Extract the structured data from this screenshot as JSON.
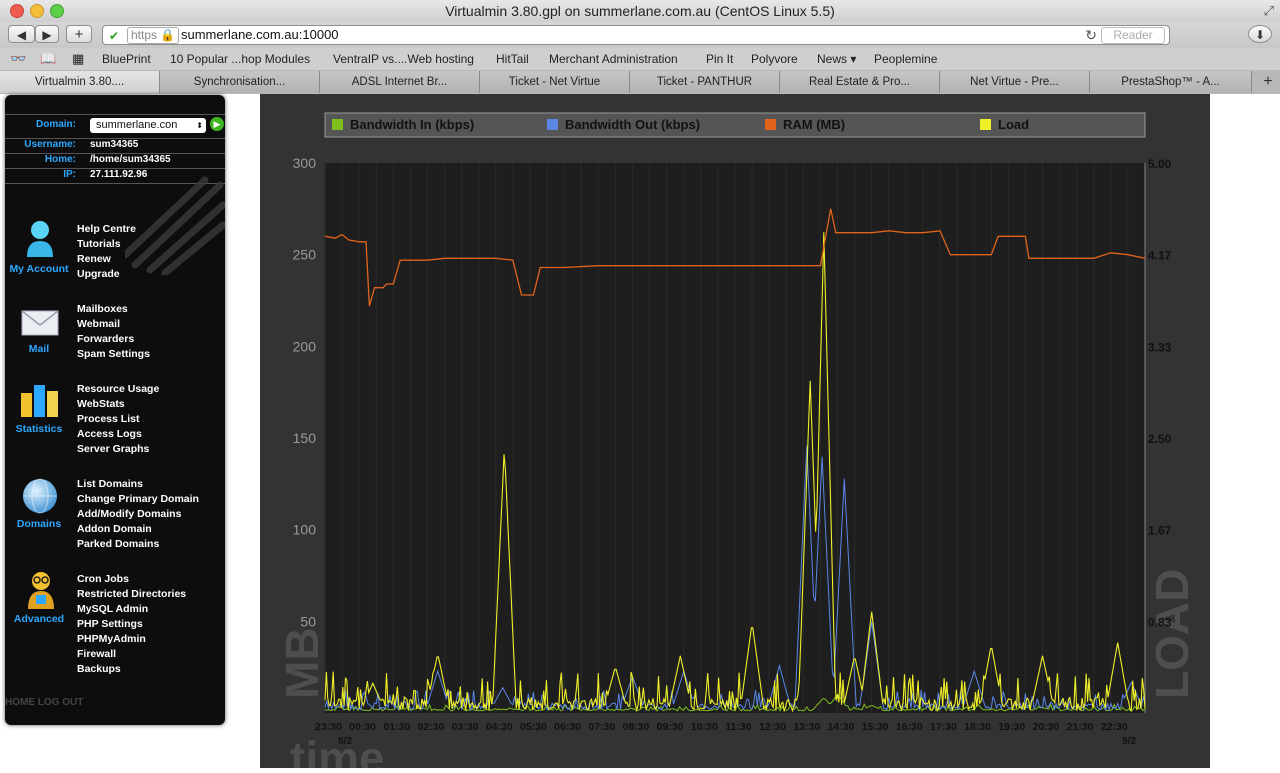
{
  "window": {
    "title": "Virtualmin 3.80.gpl on summerlane.com.au (CentOS Linux 5.5)"
  },
  "toolbar": {
    "back": "◀",
    "forward": "▶",
    "add": "+",
    "protocol": "https",
    "url": "summerlane.com.au:10000",
    "reader": "Reader"
  },
  "bookmarks": [
    "BluePrint",
    "10 Popular ...hop Modules",
    "VentraIP vs....Web hosting",
    "HitTail",
    "Merchant Administration",
    "Pin It",
    "Polyvore",
    "News ▾",
    "Peoplemine"
  ],
  "tabs": [
    "Virtualmin 3.80....",
    "Synchronisation...",
    "ADSL Internet Br...",
    "Ticket - Net Virtue",
    "Ticket - PANTHUR",
    "Real Estate & Pro...",
    "Net Virtue - Pre...",
    "PrestaShop™ - A..."
  ],
  "sidebar": {
    "domain_label": "Domain:",
    "domain_value": "summerlane.con",
    "username_label": "Username:",
    "username_value": "sum34365",
    "home_label": "Home:",
    "home_value": "/home/sum34365",
    "ip_label": "IP:",
    "ip_value": "27.111.92.96",
    "sections": [
      {
        "label": "My Account",
        "icon": "user-icon",
        "links": [
          "Help Centre",
          "Tutorials",
          "Renew",
          "Upgrade"
        ]
      },
      {
        "label": "Mail",
        "icon": "envelope-icon",
        "links": [
          "Mailboxes",
          "Webmail",
          "Forwarders",
          "Spam Settings"
        ]
      },
      {
        "label": "Statistics",
        "icon": "bar-chart-icon",
        "links": [
          "Resource Usage",
          "WebStats",
          "Process List",
          "Access Logs",
          "Server Graphs"
        ]
      },
      {
        "label": "Domains",
        "icon": "globe-icon",
        "links": [
          "List Domains",
          "Change Primary Domain",
          "Add/Modify Domains",
          "Addon Domain",
          "Parked Domains"
        ]
      },
      {
        "label": "Advanced",
        "icon": "advanced-user-icon",
        "links": [
          "Cron Jobs",
          "Restricted Directories",
          "MySQL Admin",
          "PHP Settings",
          "PHPMyAdmin",
          "Firewall",
          "Backups"
        ]
      }
    ],
    "home_link": "HOME",
    "logout_link": "LOG OUT"
  },
  "colors": {
    "bw_in": "#7dbf1c",
    "bw_out": "#5b86e6",
    "ram": "#e0641c",
    "load": "#f0f02a",
    "panel": "#333333",
    "plot": "#1e1e1e"
  },
  "chart_data": {
    "type": "line",
    "legend": [
      {
        "name": "Bandwidth In (kbps)",
        "color": "#7dbf1c"
      },
      {
        "name": "Bandwidth Out (kbps)",
        "color": "#5b86e6"
      },
      {
        "name": "RAM (MB)",
        "color": "#e0641c"
      },
      {
        "name": "Load",
        "color": "#f0f02a"
      }
    ],
    "y_left": {
      "label": "MB",
      "ticks": [
        "300",
        "250",
        "200",
        "150",
        "100",
        "50"
      ],
      "ylim": [
        0,
        300
      ]
    },
    "y_right": {
      "label": "LOAD",
      "ticks": [
        "5.00",
        "4.17",
        "3.33",
        "2.50",
        "1.67",
        "0.83"
      ],
      "ylim": [
        0,
        5
      ]
    },
    "x": {
      "label": "time",
      "ticks": [
        "23:30",
        "00:30",
        "01:30",
        "02:30",
        "03:30",
        "04:30",
        "05:30",
        "06:30",
        "07:30",
        "08:30",
        "09:30",
        "10:30",
        "11:30",
        "12:30",
        "13:30",
        "14:30",
        "15:30",
        "16:30",
        "17:30",
        "18:30",
        "19:30",
        "20:30",
        "21:30",
        "22:30"
      ],
      "start_date": "8/2",
      "end_date": "9/2",
      "range_hours": [
        0,
        24
      ]
    },
    "ram_series": [
      [
        0,
        260
      ],
      [
        0.3,
        259
      ],
      [
        0.5,
        261
      ],
      [
        0.7,
        258
      ],
      [
        1.0,
        257
      ],
      [
        1.2,
        257
      ],
      [
        1.3,
        222
      ],
      [
        1.45,
        232
      ],
      [
        1.7,
        232
      ],
      [
        1.8,
        234
      ],
      [
        2.0,
        234
      ],
      [
        2.2,
        247
      ],
      [
        3.0,
        247
      ],
      [
        3.5,
        248
      ],
      [
        4.0,
        248
      ],
      [
        5.0,
        248
      ],
      [
        5.5,
        247
      ],
      [
        5.75,
        228
      ],
      [
        6.1,
        228
      ],
      [
        6.3,
        243
      ],
      [
        7.0,
        243
      ],
      [
        8.0,
        244
      ],
      [
        9.0,
        244
      ],
      [
        10.0,
        244
      ],
      [
        11.0,
        244
      ],
      [
        12.0,
        244
      ],
      [
        13.0,
        244
      ],
      [
        14.0,
        244
      ],
      [
        14.5,
        244
      ],
      [
        14.8,
        275
      ],
      [
        14.95,
        262
      ],
      [
        15.5,
        262
      ],
      [
        16.0,
        262
      ],
      [
        16.5,
        263
      ],
      [
        17.0,
        262
      ],
      [
        17.5,
        262
      ],
      [
        18.0,
        263
      ],
      [
        18.3,
        250
      ],
      [
        19.0,
        250
      ],
      [
        19.5,
        250
      ],
      [
        19.7,
        260
      ],
      [
        20.5,
        260
      ],
      [
        20.6,
        248
      ],
      [
        21.0,
        248
      ],
      [
        21.5,
        248
      ],
      [
        22.0,
        248
      ],
      [
        22.5,
        248
      ],
      [
        23.0,
        251
      ],
      [
        23.5,
        250
      ],
      [
        24,
        248
      ]
    ],
    "load_peaks": [
      [
        0.3,
        0.05
      ],
      [
        1.4,
        0.25
      ],
      [
        3.3,
        0.52
      ],
      [
        5.25,
        2.4
      ],
      [
        8.5,
        0.4
      ],
      [
        10.4,
        0.5
      ],
      [
        12.5,
        0.8
      ],
      [
        14.2,
        3.0
      ],
      [
        14.6,
        4.35
      ],
      [
        15.5,
        0.5
      ],
      [
        16.0,
        0.9
      ],
      [
        19.5,
        0.6
      ],
      [
        21.0,
        0.5
      ],
      [
        23.2,
        0.62
      ]
    ],
    "bw_out_peaks": [
      [
        3.3,
        0.35
      ],
      [
        5.2,
        0.2
      ],
      [
        9.0,
        0.3
      ],
      [
        10.5,
        0.35
      ],
      [
        13.3,
        0.4
      ],
      [
        14.1,
        2.4
      ],
      [
        14.55,
        2.3
      ],
      [
        15.2,
        2.1
      ],
      [
        16.0,
        0.8
      ],
      [
        19.0,
        0.35
      ],
      [
        23.6,
        0.25
      ]
    ],
    "bw_in_peaks": [
      [
        2.8,
        0.03
      ],
      [
        14.6,
        0.12
      ],
      [
        15.0,
        0.15
      ],
      [
        16.0,
        0.05
      ],
      [
        21.0,
        0.03
      ]
    ]
  }
}
